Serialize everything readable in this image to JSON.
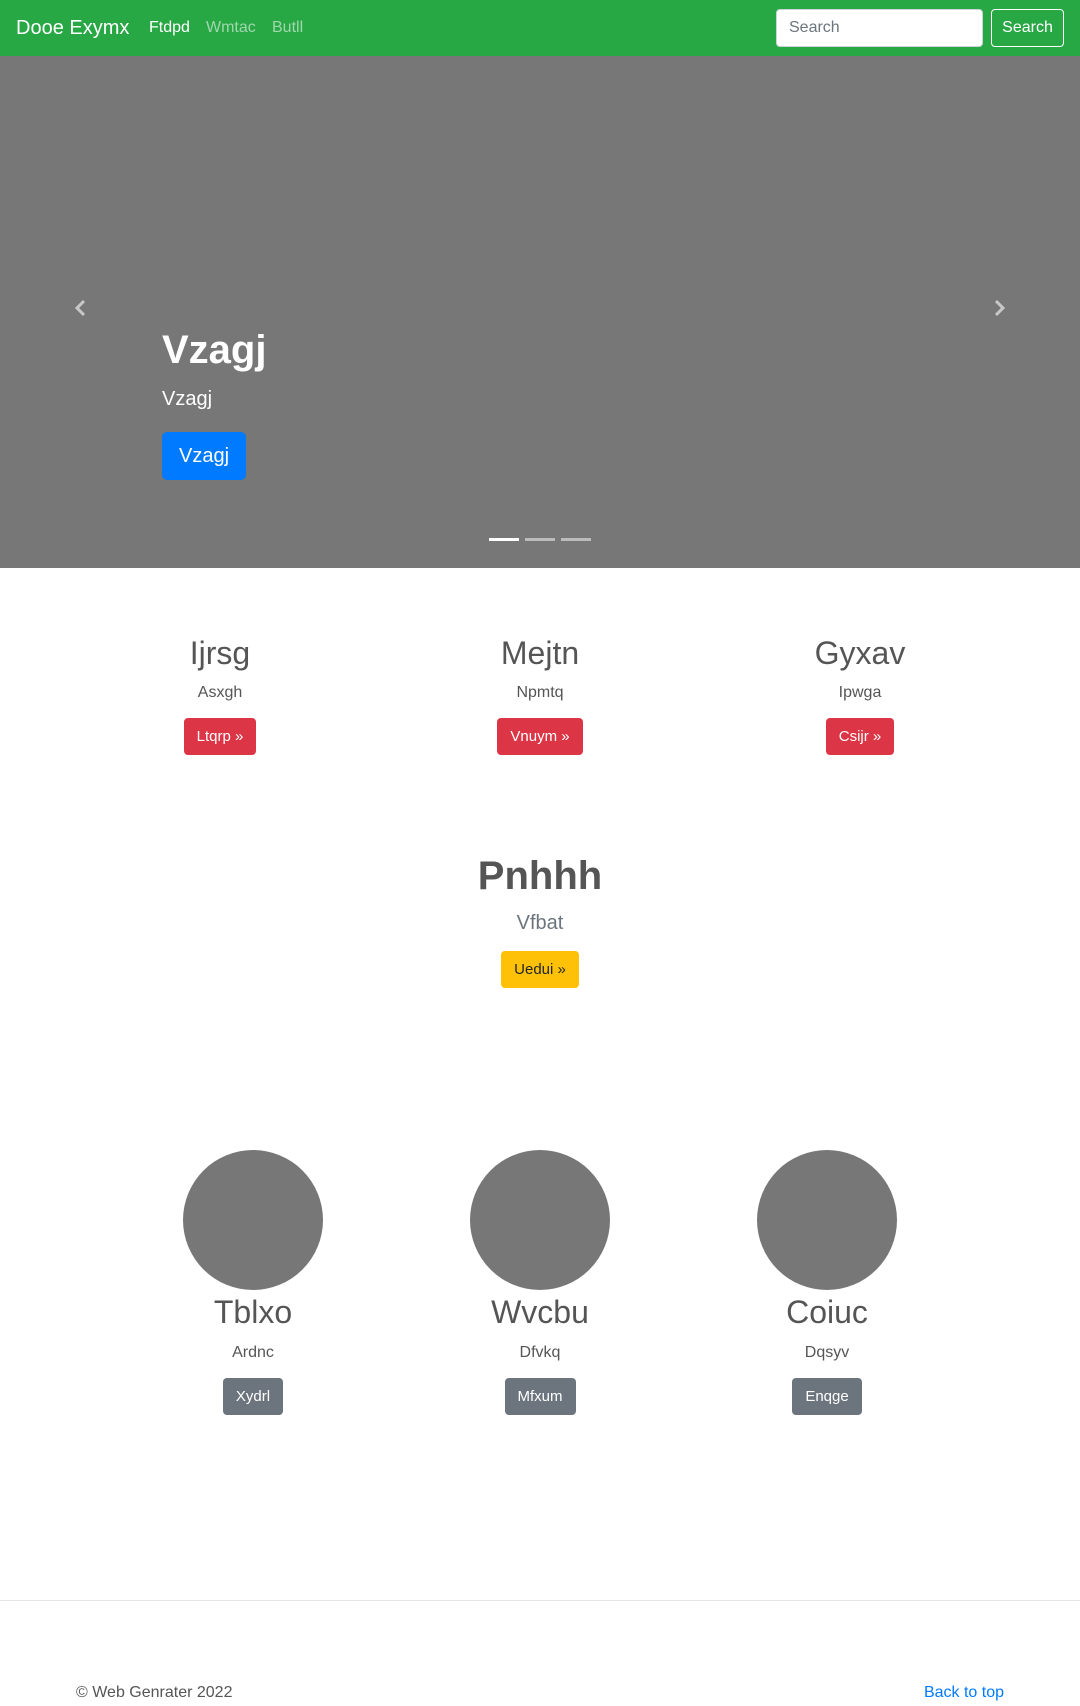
{
  "navbar": {
    "brand": "Dooe Exymx",
    "links": [
      {
        "label": "Ftdpd",
        "active": true
      },
      {
        "label": "Wmtac",
        "active": false
      },
      {
        "label": "Butll",
        "active": false
      }
    ],
    "search_placeholder": "Search",
    "search_button": "Search",
    "bg_color": "#28a745"
  },
  "carousel": {
    "title": "Vzagj",
    "subtitle": "Vzagj",
    "button": "Vzagj",
    "indicators": 3,
    "active_indicator": 0,
    "prev_icon": "chevron-left-icon",
    "next_icon": "chevron-right-icon"
  },
  "features": [
    {
      "title": "Ijrsg",
      "text": "Asxgh",
      "button": "Ltqrp »"
    },
    {
      "title": "Mejtn",
      "text": "Npmtq",
      "button": "Vnuym »"
    },
    {
      "title": "Gyxav",
      "text": "Ipwga",
      "button": "Csijr »"
    }
  ],
  "center": {
    "title": "Pnhhh",
    "text": "Vfbat",
    "button": "Uedui »"
  },
  "team": [
    {
      "title": "Tblxo",
      "text": "Ardnc",
      "button": "Xydrl"
    },
    {
      "title": "Wvcbu",
      "text": "Dfvkq",
      "button": "Mfxum"
    },
    {
      "title": "Coiuc",
      "text": "Dqsyv",
      "button": "Enqge"
    }
  ],
  "footer": {
    "copyright": "© Web Genrater 2022",
    "back_to_top": "Back to top"
  }
}
